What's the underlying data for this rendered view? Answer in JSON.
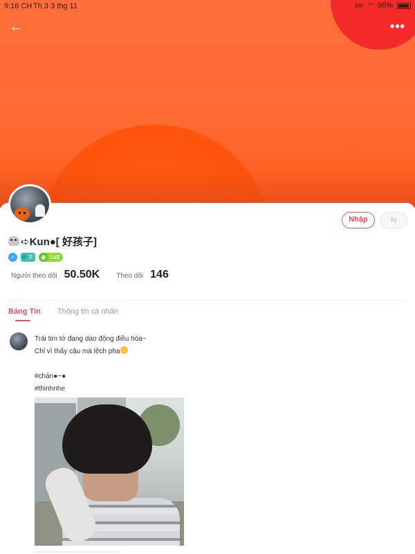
{
  "status_bar": {
    "time": "9:18 CH",
    "date": "Th 3 3 thg 11",
    "battery": "96%",
    "icons": [
      "signal-icon",
      "wifi-icon",
      "battery-icon"
    ]
  },
  "header": {
    "back_icon": "arrow-left-icon",
    "back_glyph": "←",
    "more_icon": "more-horizontal-icon",
    "more_glyph": "•••"
  },
  "profile": {
    "username": "➪Kun●[ 好孩子]",
    "join_button": "Nhập",
    "swap_icon": "swap-icon",
    "swap_glyph": "⇆",
    "badges": {
      "gender": "♂",
      "level": "7",
      "lv": "Lv2"
    },
    "stats": {
      "followers_label": "Người theo dõi",
      "followers_value": "50.50K",
      "following_label": "Theo dõi",
      "following_value": "146"
    }
  },
  "tabs": [
    {
      "label": "Bảng Tin",
      "active": true
    },
    {
      "label": "Thông tin cá nhân",
      "active": false
    }
  ],
  "post": {
    "lines": [
      "Trái tim tớ đang dao động điều hòa~",
      "Chỉ vì thấy cậu mà lệch pha",
      "",
      "#chán●~●",
      "#thinhnhe"
    ],
    "emoji_icon": "grinning-face-icon"
  },
  "colors": {
    "banner": "#ff6e3c",
    "sun": "#ff5a12",
    "accent": "#e24e5a",
    "blob": "#f52a2a"
  }
}
